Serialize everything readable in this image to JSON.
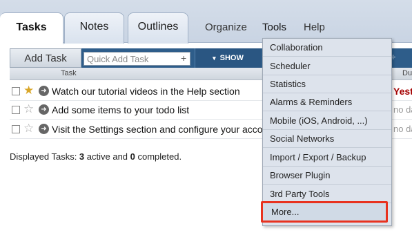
{
  "nav": {
    "tabs": [
      {
        "label": "Tasks",
        "active": true
      },
      {
        "label": "Notes",
        "active": false
      },
      {
        "label": "Outlines",
        "active": false
      }
    ],
    "menus": [
      "Organize",
      "Tools",
      "Help"
    ]
  },
  "toolbar": {
    "add_task_label": "Add Task",
    "quick_add_placeholder": "Quick Add Task",
    "quick_add_plus": "+",
    "show_label": "SHOW",
    "show_arrow": "▾"
  },
  "columns": {
    "task": "Task",
    "due": "Due D"
  },
  "tasks": [
    {
      "starred": true,
      "text": "Watch our tutorial videos in the Help section",
      "due": "Yest"
    },
    {
      "starred": false,
      "text": "Add some items to your todo list",
      "due": "no da"
    },
    {
      "starred": false,
      "text": "Visit the Settings section and configure your account",
      "due": "no da"
    }
  ],
  "summary": {
    "prefix": "Displayed Tasks: ",
    "active_count": "3",
    "middle": " active and ",
    "completed_count": "0",
    "suffix": " completed."
  },
  "tools_menu": {
    "items": [
      "Collaboration",
      "Scheduler",
      "Statistics",
      "Alarms & Reminders",
      "Mobile (iOS, Android, ...)",
      "Social Networks",
      "Import / Export / Backup",
      "Browser Plugin",
      "3rd Party Tools",
      "More..."
    ],
    "highlighted": "More...",
    "highlight_color": "#e8321f"
  },
  "colors": {
    "toolbar_blue": "#2e5d8a",
    "star_gold": "#d9a628",
    "overdue_red": "#a40000"
  }
}
